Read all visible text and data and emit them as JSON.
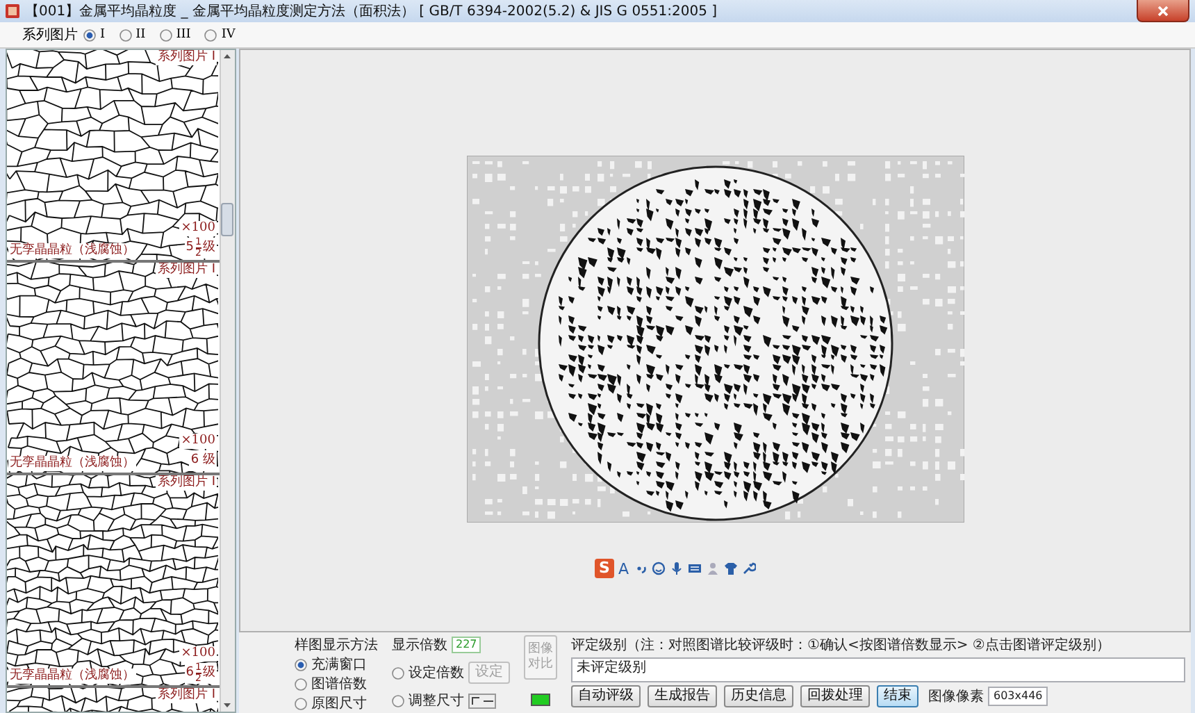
{
  "window": {
    "title": "【001】金属平均晶粒度 _ 金属平均晶粒度测定方法（面积法） [ GB/T 6394-2002(5.2) & JIS G 0551:2005 ]"
  },
  "series_selector": {
    "label": "系列图片",
    "options": [
      {
        "label": "I",
        "selected": true
      },
      {
        "label": "II",
        "selected": false
      },
      {
        "label": "III",
        "selected": false
      },
      {
        "label": "IV",
        "selected": false
      }
    ]
  },
  "thumbnails": [
    {
      "series": "系列图片 I",
      "caption": "无孪晶晶粒（浅腐蚀）",
      "magnification": "×100",
      "grade": "5",
      "fraction": {
        "numerator": "1",
        "denominator": "2"
      },
      "unit": "级"
    },
    {
      "series": "系列图片 I",
      "caption": "无孪晶晶粒（浅腐蚀）",
      "magnification": "×100",
      "grade": "6",
      "unit": "级"
    },
    {
      "series": "系列图片 I",
      "caption": "无孪晶晶粒（浅腐蚀）",
      "magnification": "×100",
      "grade": "6",
      "fraction": {
        "numerator": "1",
        "denominator": "2"
      },
      "unit": "级"
    },
    {
      "series": "系列图片 I"
    }
  ],
  "ime_toolbar": {
    "logo": "S",
    "letter": "A"
  },
  "display_method": {
    "label": "样图显示方法",
    "options": [
      {
        "label": "充满窗口",
        "selected": true
      },
      {
        "label": "图谱倍数",
        "selected": false
      },
      {
        "label": "原图尺寸",
        "selected": false
      }
    ]
  },
  "magnification": {
    "label": "显示倍数",
    "value": "227",
    "options": [
      {
        "kind": "set",
        "label": "设定倍数",
        "selected": false,
        "button": {
          "label": "设定",
          "disabled": true
        }
      },
      {
        "kind": "resize",
        "label": "调整尺寸",
        "selected": false
      }
    ]
  },
  "compare_button": {
    "label": "图像对比",
    "disabled": true
  },
  "grading": {
    "label": "评定级别（注：对照图谱比较评级时：①确认<按图谱倍数显示> ②点击图谱评定级别）",
    "value": "未评定级别"
  },
  "status_light": {
    "on": true
  },
  "actions": [
    {
      "label": "自动评级",
      "focused": false
    },
    {
      "label": "生成报告",
      "focused": false
    },
    {
      "label": "历史信息",
      "focused": false
    },
    {
      "label": "回拨处理",
      "focused": false
    },
    {
      "label": "结束",
      "focused": true
    }
  ],
  "pixels": {
    "label": "图像像素",
    "value": "603x446"
  }
}
